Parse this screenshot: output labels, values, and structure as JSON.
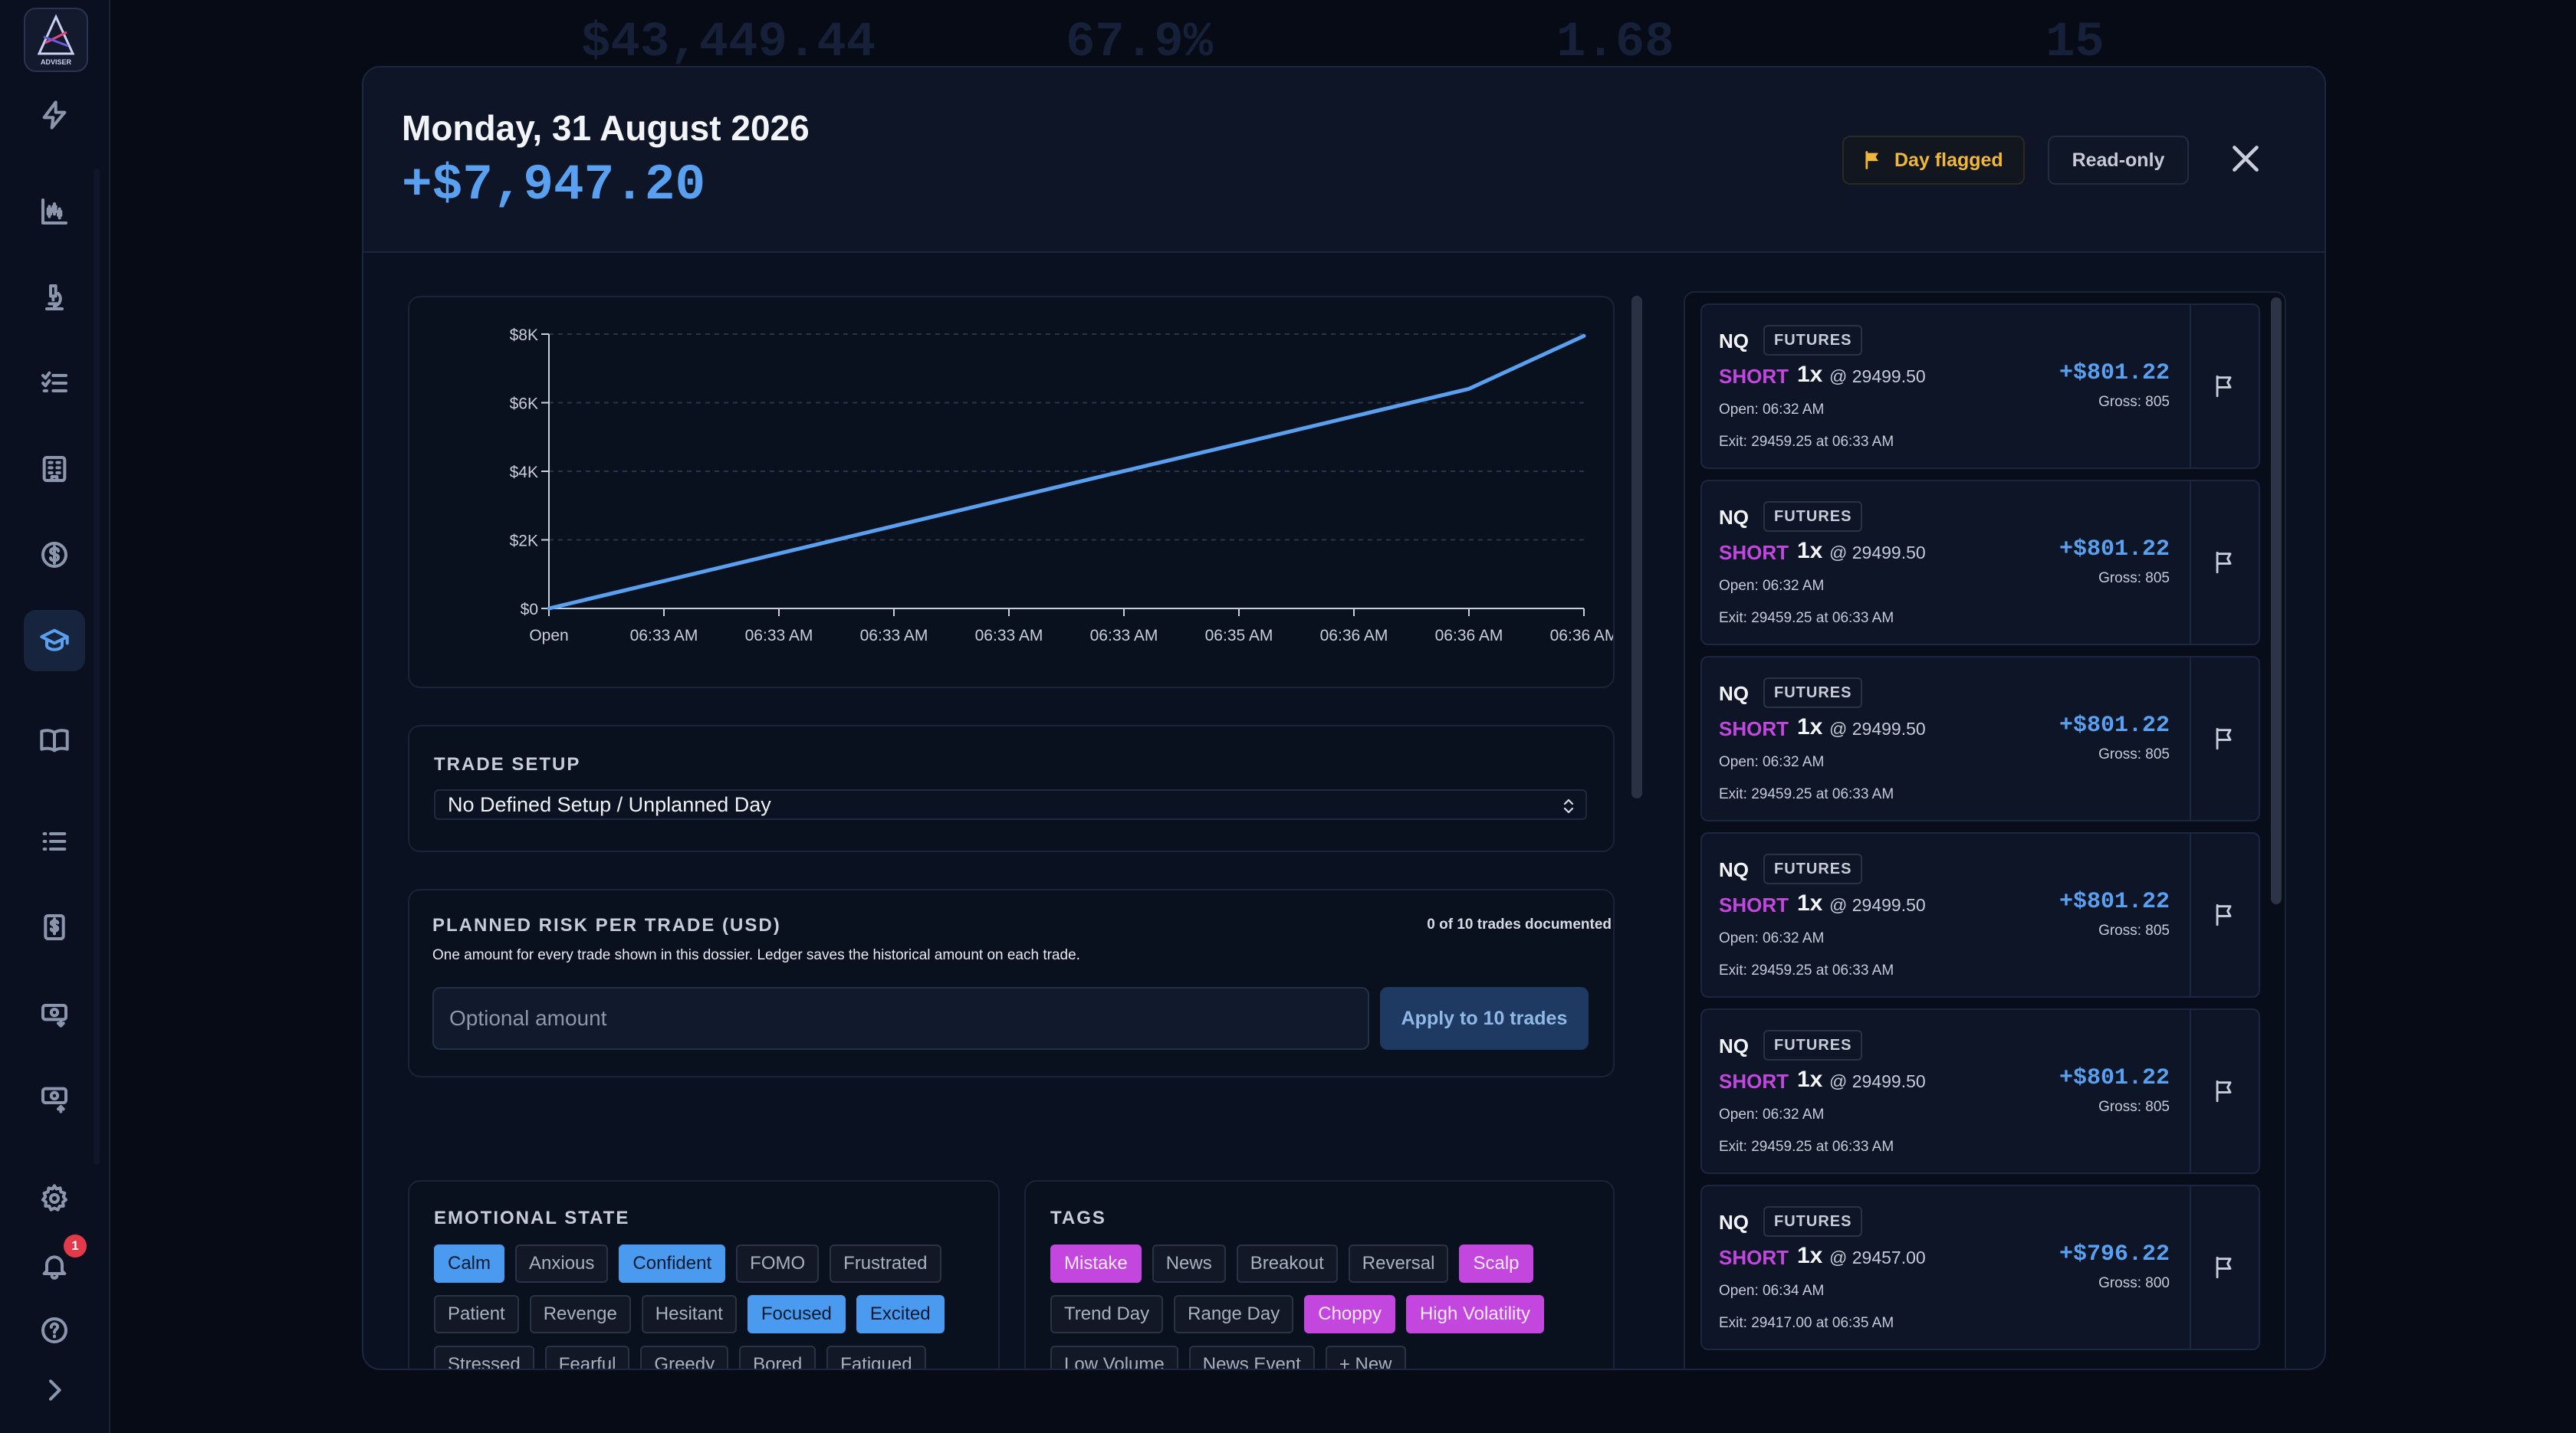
{
  "background": {
    "ghost_values": [
      "$43,449.44",
      "67.9%",
      "1.68",
      "15"
    ]
  },
  "sidebar": {
    "logo_text": "ADVISER",
    "items": [
      {
        "icon": "bolt-icon"
      },
      {
        "icon": "chart-candles-icon"
      },
      {
        "icon": "microscope-icon"
      },
      {
        "icon": "checklist-icon"
      },
      {
        "icon": "building-icon"
      },
      {
        "icon": "dollar-circle-icon"
      },
      {
        "icon": "graduation-cap-icon",
        "active": true
      },
      {
        "icon": "book-icon"
      },
      {
        "icon": "list-icon"
      },
      {
        "icon": "receipt-dollar-icon"
      },
      {
        "icon": "money-in-icon"
      },
      {
        "icon": "money-out-icon"
      }
    ],
    "notification_count": "1"
  },
  "modal": {
    "title": "Monday, 31 August 2026",
    "day_pnl": "+$7,947.20",
    "flag_label": "Day flagged",
    "readonly_label": "Read-only",
    "accent_color": "#5aa0f0",
    "flag_color": "#f0b73a"
  },
  "chart_data": {
    "type": "line",
    "x": [
      "Open",
      "06:33 AM",
      "06:33 AM",
      "06:33 AM",
      "06:33 AM",
      "06:33 AM",
      "06:35 AM",
      "06:36 AM",
      "06:36 AM",
      "06:36 AM"
    ],
    "y": [
      0,
      801.22,
      1602.44,
      2403.66,
      3204.88,
      4006.1,
      4802.32,
      5603.54,
      6404.76,
      7947.2
    ],
    "ylim": [
      0,
      8000
    ],
    "yticks": [
      "$0",
      "$2K",
      "$4K",
      "$6K",
      "$8K"
    ],
    "grid": true,
    "line_color": "#5aa0f0"
  },
  "trade_setup": {
    "label": "TRADE SETUP",
    "selected": "No Defined Setup / Unplanned Day"
  },
  "planned_risk": {
    "label": "PLANNED RISK PER TRADE (USD)",
    "description": "One amount for every trade shown in this dossier. Ledger saves the historical amount on each trade.",
    "documented": "0 of 10 trades documented",
    "placeholder": "Optional amount",
    "apply_label": "Apply to 10 trades"
  },
  "emotional_state": {
    "label": "EMOTIONAL STATE",
    "chips": [
      {
        "text": "Calm",
        "active": true
      },
      {
        "text": "Anxious",
        "active": false
      },
      {
        "text": "Confident",
        "active": true
      },
      {
        "text": "FOMO",
        "active": false
      },
      {
        "text": "Frustrated",
        "active": false
      },
      {
        "text": "Patient",
        "active": false
      },
      {
        "text": "Revenge",
        "active": false
      },
      {
        "text": "Hesitant",
        "active": false
      },
      {
        "text": "Focused",
        "active": true
      },
      {
        "text": "Excited",
        "active": true
      },
      {
        "text": "Stressed",
        "active": false
      },
      {
        "text": "Fearful",
        "active": false
      },
      {
        "text": "Greedy",
        "active": false
      },
      {
        "text": "Bored",
        "active": false
      },
      {
        "text": "Fatigued",
        "active": false
      }
    ]
  },
  "tags": {
    "label": "TAGS",
    "chips": [
      {
        "text": "Mistake",
        "active": true
      },
      {
        "text": "News",
        "active": false
      },
      {
        "text": "Breakout",
        "active": false
      },
      {
        "text": "Reversal",
        "active": false
      },
      {
        "text": "Scalp",
        "active": true
      },
      {
        "text": "Trend Day",
        "active": false
      },
      {
        "text": "Range Day",
        "active": false
      },
      {
        "text": "Choppy",
        "active": true
      },
      {
        "text": "High Volatility",
        "active": true
      },
      {
        "text": "Low Volume",
        "active": false
      },
      {
        "text": "News Event",
        "active": false
      }
    ],
    "new_label": "+ New"
  },
  "trades": [
    {
      "symbol": "NQ",
      "type": "FUTURES",
      "side": "SHORT",
      "qty": "1x",
      "price": "@ 29499.50",
      "open": "Open: 06:32 AM",
      "exit": "Exit: 29459.25 at 06:33 AM",
      "pnl": "+$801.22",
      "gross": "Gross: 805"
    },
    {
      "symbol": "NQ",
      "type": "FUTURES",
      "side": "SHORT",
      "qty": "1x",
      "price": "@ 29499.50",
      "open": "Open: 06:32 AM",
      "exit": "Exit: 29459.25 at 06:33 AM",
      "pnl": "+$801.22",
      "gross": "Gross: 805"
    },
    {
      "symbol": "NQ",
      "type": "FUTURES",
      "side": "SHORT",
      "qty": "1x",
      "price": "@ 29499.50",
      "open": "Open: 06:32 AM",
      "exit": "Exit: 29459.25 at 06:33 AM",
      "pnl": "+$801.22",
      "gross": "Gross: 805"
    },
    {
      "symbol": "NQ",
      "type": "FUTURES",
      "side": "SHORT",
      "qty": "1x",
      "price": "@ 29499.50",
      "open": "Open: 06:32 AM",
      "exit": "Exit: 29459.25 at 06:33 AM",
      "pnl": "+$801.22",
      "gross": "Gross: 805"
    },
    {
      "symbol": "NQ",
      "type": "FUTURES",
      "side": "SHORT",
      "qty": "1x",
      "price": "@ 29499.50",
      "open": "Open: 06:32 AM",
      "exit": "Exit: 29459.25 at 06:33 AM",
      "pnl": "+$801.22",
      "gross": "Gross: 805"
    },
    {
      "symbol": "NQ",
      "type": "FUTURES",
      "side": "SHORT",
      "qty": "1x",
      "price": "@ 29457.00",
      "open": "Open: 06:34 AM",
      "exit": "Exit: 29417.00 at 06:35 AM",
      "pnl": "+$796.22",
      "gross": "Gross: 800"
    }
  ]
}
